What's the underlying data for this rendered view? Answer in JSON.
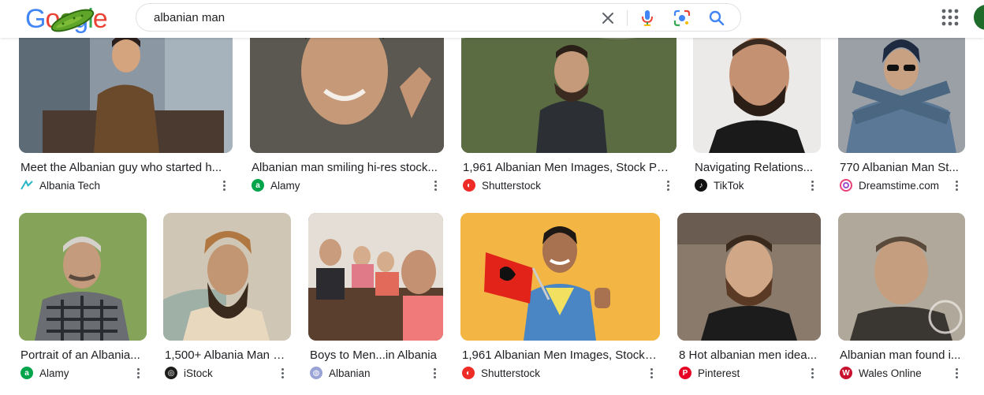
{
  "search": {
    "value": "albanian man"
  },
  "logo": {
    "letters": [
      "G",
      "o",
      "o",
      "g",
      "l",
      "e"
    ]
  },
  "colors": {
    "blue": "#4285f4",
    "red": "#ea4335",
    "yellow": "#fbbc05",
    "green": "#34a853"
  },
  "icons": {
    "clear": "close-icon",
    "voice": "microphone-icon",
    "lens": "camera-lens-icon",
    "search": "search-icon",
    "apps": "apps-grid-icon",
    "more": "more-vert-icon"
  },
  "results": [
    {
      "title": "Meet the Albanian guy who started h...",
      "source": "Albania Tech",
      "fav_icon": "albania-tech-icon"
    },
    {
      "title": "Albanian man smiling hi-res stock...",
      "source": "Alamy",
      "fav_icon": "alamy-icon"
    },
    {
      "title": "1,961 Albanian Men Images, Stock Pho...",
      "source": "Shutterstock",
      "fav_icon": "shutterstock-icon"
    },
    {
      "title": "Navigating Relations...",
      "source": "TikTok",
      "fav_icon": "tiktok-icon"
    },
    {
      "title": "770 Albanian Man St...",
      "source": "Dreamstime.com",
      "fav_icon": "dreamstime-icon"
    },
    {
      "title": "Portrait of an Albania...",
      "source": "Alamy",
      "fav_icon": "alamy-icon"
    },
    {
      "title": "1,500+ Albania Man S...",
      "source": "iStock",
      "fav_icon": "istock-icon"
    },
    {
      "title": "Boys to Men...in Albania",
      "source": "Albanian",
      "fav_icon": "albanian-site-icon"
    },
    {
      "title": "1,961 Albanian Men Images, Stock ...",
      "source": "Shutterstock",
      "fav_icon": "shutterstock-icon"
    },
    {
      "title": "8 Hot albanian men idea...",
      "source": "Pinterest",
      "fav_icon": "pinterest-icon"
    },
    {
      "title": "Albanian man found i...",
      "source": "Wales Online",
      "fav_icon": "wales-online-icon"
    }
  ]
}
